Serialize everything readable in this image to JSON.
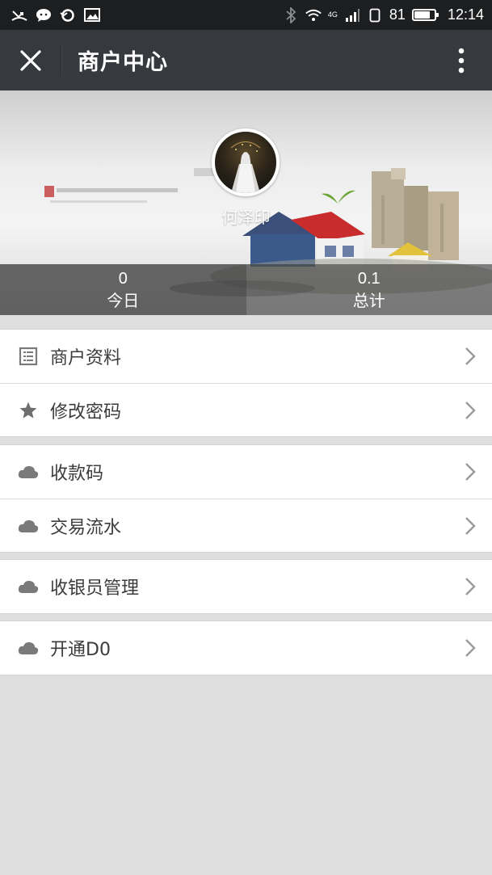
{
  "status_bar": {
    "battery_percent": "81",
    "time": "12:14",
    "network": "4G",
    "left_icons": [
      "missed-call-icon",
      "chat-icon",
      "sync-icon",
      "image-icon"
    ],
    "right_icons": [
      "bluetooth-icon",
      "wifi-icon",
      "signal-icon",
      "sim-icon",
      "battery-icon"
    ]
  },
  "header": {
    "title": "商户中心",
    "close_icon": "close-icon",
    "more_icon": "more-vertical-icon"
  },
  "profile": {
    "name": "何泽印",
    "stats": [
      {
        "value": "0",
        "label": "今日"
      },
      {
        "value": "0.1",
        "label": "总计"
      }
    ]
  },
  "menu_groups": [
    {
      "items": [
        {
          "label": "商户资料",
          "icon": "list-icon"
        },
        {
          "label": "修改密码",
          "icon": "star-icon"
        }
      ]
    },
    {
      "items": [
        {
          "label": "收款码",
          "icon": "cloud-icon"
        },
        {
          "label": "交易流水",
          "icon": "cloud-icon"
        }
      ]
    },
    {
      "items": [
        {
          "label": "收银员管理",
          "icon": "cloud-icon"
        }
      ]
    },
    {
      "items": [
        {
          "label": "开通D0",
          "icon": "cloud-icon"
        }
      ]
    }
  ],
  "colors": {
    "status_bar": "#1c1e20",
    "title_bar": "#36393d",
    "page_background": "#dedfde",
    "menu_text": "#3b3b3b",
    "icon_gray": "#7a7a7a"
  }
}
